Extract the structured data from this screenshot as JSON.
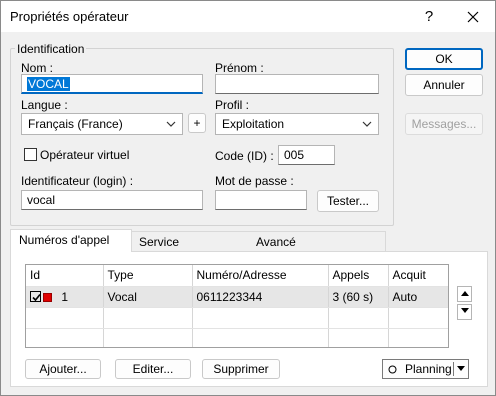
{
  "window": {
    "title": "Propriétés opérateur",
    "help_glyph": "?"
  },
  "identification": {
    "legend": "Identification",
    "nom_label": "Nom :",
    "nom_value": "VOCAL",
    "prenom_label": "Prénom :",
    "prenom_value": "",
    "langue_label": "Langue :",
    "langue_value": "Français (France)",
    "plus_label": "+",
    "profil_label": "Profil :",
    "profil_value": "Exploitation",
    "virtuel_label": "Opérateur virtuel",
    "virtuel_checked": false,
    "code_label": "Code (ID) :",
    "code_value": "005",
    "login_label": "Identificateur (login) :",
    "login_value": "vocal",
    "password_label": "Mot de passe :",
    "password_value": "",
    "tester_label": "Tester..."
  },
  "buttons": {
    "ok": "OK",
    "annuler": "Annuler",
    "messages": "Messages..."
  },
  "tabs": [
    {
      "label": "Numéros d'appel",
      "active": true
    },
    {
      "label": "Service",
      "active": false
    },
    {
      "label": "Avancé",
      "active": false
    }
  ],
  "table": {
    "columns": [
      "Id",
      "Type",
      "Numéro/Adresse",
      "Appels",
      "Acquit"
    ],
    "rows": [
      {
        "checked": true,
        "status_color": "#e00000",
        "id": "1",
        "type": "Vocal",
        "numero": "0611223344",
        "appels": "3 (60 s)",
        "acquit": "Auto"
      }
    ]
  },
  "bottom_buttons": {
    "ajouter": "Ajouter...",
    "editer": "Editer...",
    "supprimer": "Supprimer",
    "planning": "Planning"
  },
  "colors": {
    "accent": "#0067c0",
    "selection": "#0078d7",
    "status_red": "#e00000"
  }
}
